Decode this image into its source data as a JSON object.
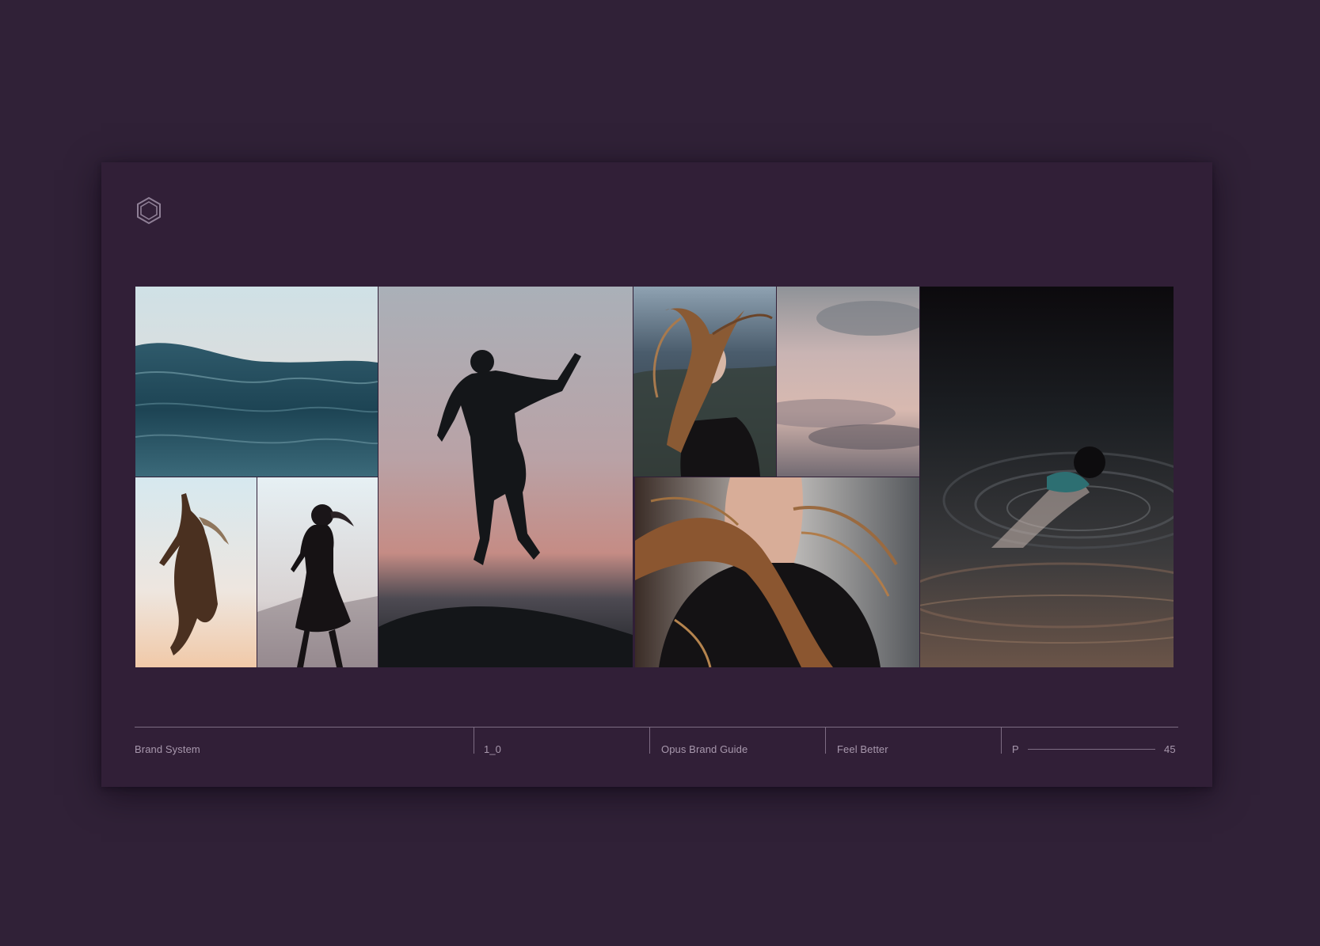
{
  "page": {
    "background": "#302137",
    "card_background": "#311f37",
    "accent_line": "#7d6c83",
    "text_color": "#a898ad"
  },
  "logo": {
    "icon": "hexagon-outline-icon"
  },
  "gallery": {
    "tiles": [
      {
        "subject": "ocean-waves-photo"
      },
      {
        "subject": "woman-jumping-silhouette-photo"
      },
      {
        "subject": "woman-dress-silhouette-photo"
      },
      {
        "subject": "man-jumping-silhouette-photo"
      },
      {
        "subject": "woman-windblown-hair-photo"
      },
      {
        "subject": "cloudy-sky-photo"
      },
      {
        "subject": "windblown-hair-closeup-photo"
      },
      {
        "subject": "person-swimming-dark-water-photo"
      }
    ]
  },
  "footer": {
    "section": "Brand System",
    "version": "1_0",
    "document": "Opus Brand Guide",
    "tagline": "Feel Better",
    "page_prefix": "P",
    "page_number": "45"
  }
}
